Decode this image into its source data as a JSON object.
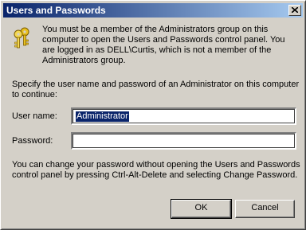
{
  "window": {
    "title": "Users and Passwords",
    "close_icon": "close-icon"
  },
  "message": {
    "icon": "keys-icon",
    "lines": [
      "You must be a member of the Administrators group on this",
      "computer to open the Users and Passwords control panel.  You",
      "are logged in as DELL\\Curtis, which is not a member of the",
      "Administrators group."
    ]
  },
  "prompt": {
    "lines": [
      "Specify the user name and password of an Administrator on this computer",
      "to continue:"
    ]
  },
  "form": {
    "username_label": "User name:",
    "username_value": "Administrator",
    "password_label": "Password:",
    "password_value": ""
  },
  "help": {
    "lines": [
      "You can change your password without opening the Users and Passwords",
      "control panel by pressing Ctrl-Alt-Delete and selecting Change Password."
    ]
  },
  "buttons": {
    "ok_label": "OK",
    "cancel_label": "Cancel"
  },
  "colors": {
    "titlebar_start": "#0a246a",
    "titlebar_end": "#a6caf0",
    "dialog_face": "#d4d0c8",
    "selection": "#0a246a"
  }
}
